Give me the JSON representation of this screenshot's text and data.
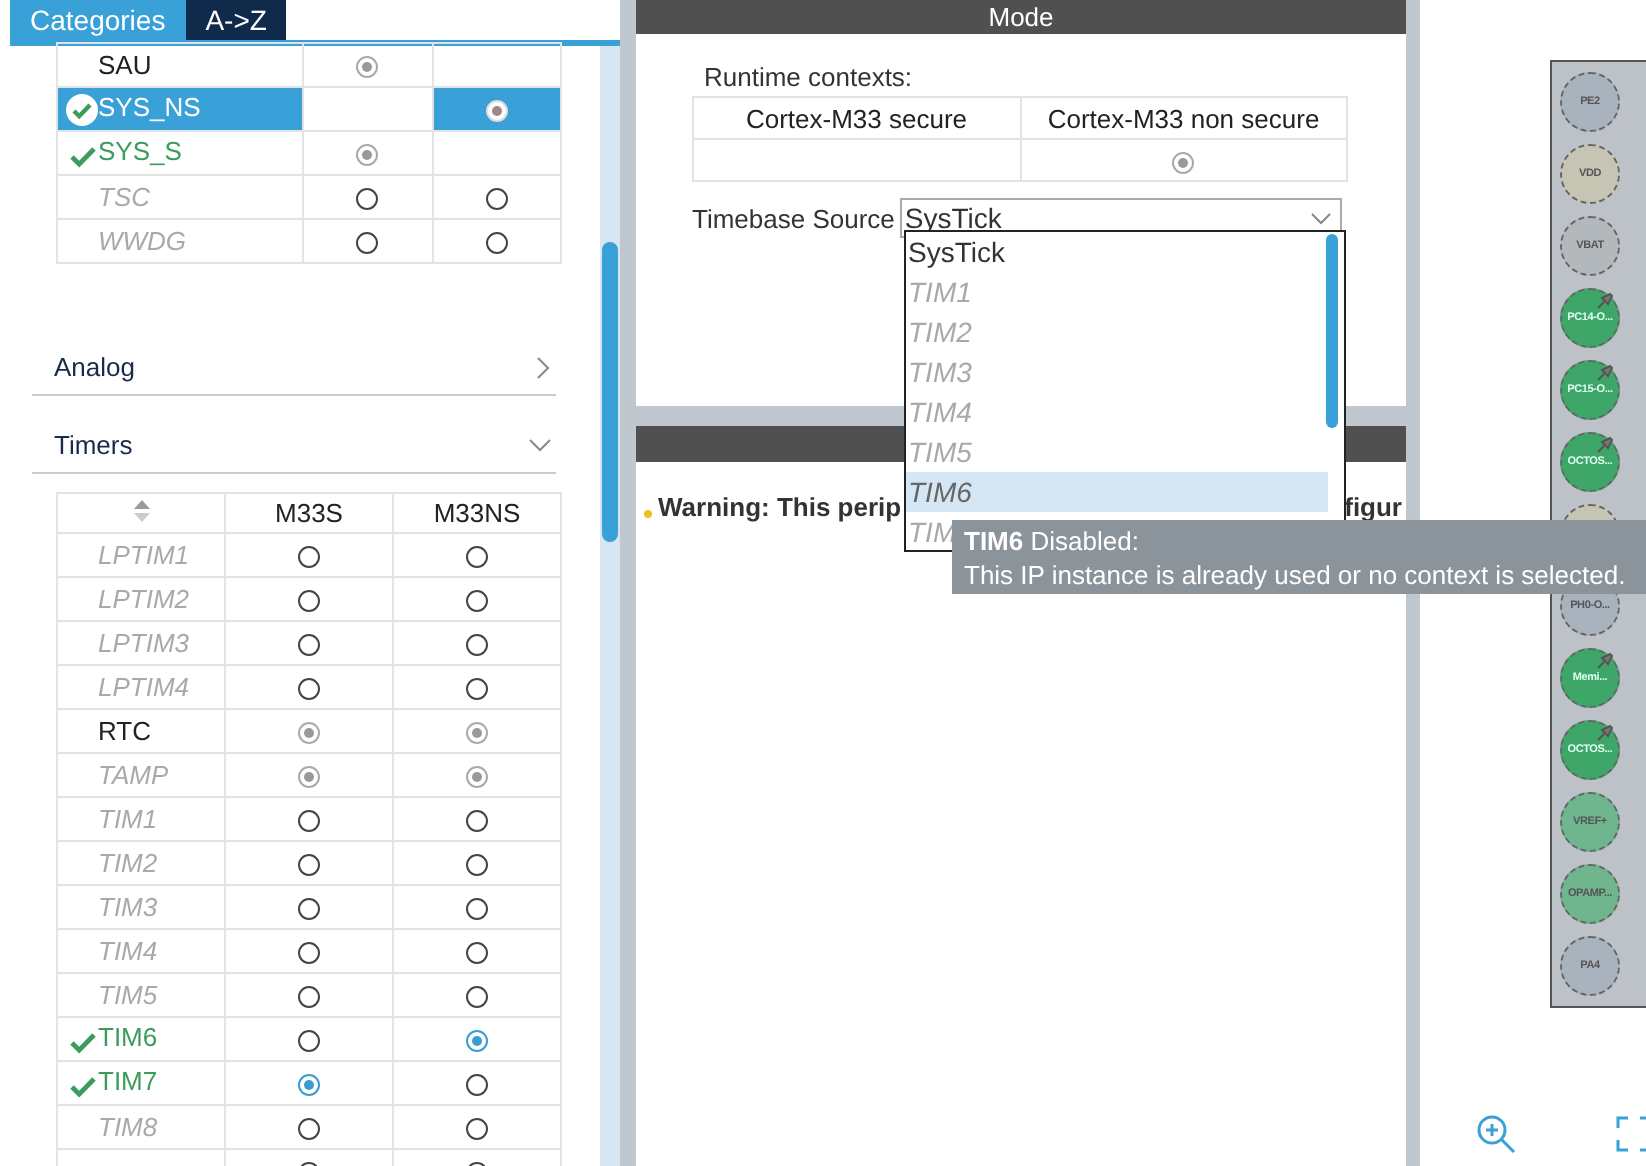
{
  "tabs": [
    {
      "label": "Categories",
      "selected": true
    },
    {
      "label": "A->Z",
      "selected": false
    }
  ],
  "system_rows": [
    {
      "name": "SAU",
      "disabled": false,
      "configured": false,
      "selected": false,
      "m33s": {
        "checked": true,
        "disabled": true
      }
    },
    {
      "name": "SYS_NS",
      "disabled": false,
      "configured": true,
      "selected": true,
      "m33ns": {
        "checked": true,
        "disabled": true
      }
    },
    {
      "name": "SYS_S",
      "disabled": false,
      "configured": true,
      "selected": false,
      "m33s": {
        "checked": true,
        "disabled": true
      }
    },
    {
      "name": "TSC",
      "disabled": true,
      "configured": false,
      "selected": false,
      "m33s": {
        "checked": false,
        "disabled": false
      },
      "m33ns": {
        "checked": false,
        "disabled": false
      }
    },
    {
      "name": "WWDG",
      "disabled": true,
      "configured": false,
      "selected": false,
      "m33s": {
        "checked": false,
        "disabled": false
      },
      "m33ns": {
        "checked": false,
        "disabled": false
      }
    }
  ],
  "categories": [
    {
      "label": "Analog",
      "expanded": false
    },
    {
      "label": "Timers",
      "expanded": true,
      "columns": [
        "M33S",
        "M33NS"
      ],
      "rows": [
        {
          "name": "LPTIM1",
          "disabled": true,
          "configured": false,
          "m33s": {
            "checked": false,
            "disabled": false
          },
          "m33ns": {
            "checked": false,
            "disabled": false
          }
        },
        {
          "name": "LPTIM2",
          "disabled": true,
          "configured": false,
          "m33s": {
            "checked": false,
            "disabled": false
          },
          "m33ns": {
            "checked": false,
            "disabled": false
          }
        },
        {
          "name": "LPTIM3",
          "disabled": true,
          "configured": false,
          "m33s": {
            "checked": false,
            "disabled": false
          },
          "m33ns": {
            "checked": false,
            "disabled": false
          }
        },
        {
          "name": "LPTIM4",
          "disabled": true,
          "configured": false,
          "m33s": {
            "checked": false,
            "disabled": false
          },
          "m33ns": {
            "checked": false,
            "disabled": false
          }
        },
        {
          "name": "RTC",
          "disabled": false,
          "configured": false,
          "m33s": {
            "checked": true,
            "disabled": true
          },
          "m33ns": {
            "checked": true,
            "disabled": true
          }
        },
        {
          "name": "TAMP",
          "disabled": true,
          "configured": false,
          "m33s": {
            "checked": true,
            "disabled": true
          },
          "m33ns": {
            "checked": true,
            "disabled": true
          }
        },
        {
          "name": "TIM1",
          "disabled": true,
          "configured": false,
          "m33s": {
            "checked": false,
            "disabled": false
          },
          "m33ns": {
            "checked": false,
            "disabled": false
          }
        },
        {
          "name": "TIM2",
          "disabled": true,
          "configured": false,
          "m33s": {
            "checked": false,
            "disabled": false
          },
          "m33ns": {
            "checked": false,
            "disabled": false
          }
        },
        {
          "name": "TIM3",
          "disabled": true,
          "configured": false,
          "m33s": {
            "checked": false,
            "disabled": false
          },
          "m33ns": {
            "checked": false,
            "disabled": false
          }
        },
        {
          "name": "TIM4",
          "disabled": true,
          "configured": false,
          "m33s": {
            "checked": false,
            "disabled": false
          },
          "m33ns": {
            "checked": false,
            "disabled": false
          }
        },
        {
          "name": "TIM5",
          "disabled": true,
          "configured": false,
          "m33s": {
            "checked": false,
            "disabled": false
          },
          "m33ns": {
            "checked": false,
            "disabled": false
          }
        },
        {
          "name": "TIM6",
          "disabled": false,
          "configured": true,
          "m33s": {
            "checked": false,
            "disabled": false
          },
          "m33ns": {
            "checked": true,
            "disabled": false
          }
        },
        {
          "name": "TIM7",
          "disabled": false,
          "configured": true,
          "m33s": {
            "checked": true,
            "disabled": false
          },
          "m33ns": {
            "checked": false,
            "disabled": false
          }
        },
        {
          "name": "TIM8",
          "disabled": true,
          "configured": false,
          "m33s": {
            "checked": false,
            "disabled": false
          },
          "m33ns": {
            "checked": false,
            "disabled": false
          }
        },
        {
          "disabled": true,
          "configured": false,
          "m33s": {
            "checked": false,
            "disabled": false
          },
          "m33ns": {
            "checked": false,
            "disabled": false
          }
        }
      ]
    }
  ],
  "mode": {
    "title": "Mode",
    "runtime_label": "Runtime contexts:",
    "runtime_contexts": [
      {
        "name": "Cortex-M33 secure"
      },
      {
        "name": "Cortex-M33 non secure",
        "radio": {
          "checked": true,
          "disabled": true
        }
      }
    ],
    "timebase_label": "Timebase Source",
    "timebase_value": "SysTick",
    "options": [
      {
        "label": "SysTick",
        "disabled": false,
        "hovered": false
      },
      {
        "label": "TIM1",
        "disabled": true,
        "hovered": false
      },
      {
        "label": "TIM2",
        "disabled": true,
        "hovered": false
      },
      {
        "label": "TIM3",
        "disabled": true,
        "hovered": false
      },
      {
        "label": "TIM4",
        "disabled": true,
        "hovered": false
      },
      {
        "label": "TIM5",
        "disabled": true,
        "hovered": false
      },
      {
        "label": "TIM6",
        "disabled": true,
        "hovered": true
      },
      {
        "label": "TIM",
        "disabled": true,
        "hovered": false
      }
    ],
    "warning_start": "Warning: This perip",
    "warning_end": "figur",
    "tooltip": {
      "title": "**TIM6** Disabled:",
      "text": "This IP instance is already used or no context is selected."
    }
  },
  "pins": [
    {
      "label": "PE2",
      "color": "#a9b3be",
      "pinned": false
    },
    {
      "label": "VDD",
      "color": "#c6c4b2",
      "pinned": false
    },
    {
      "label": "VBAT",
      "color": "#b3b8bd",
      "pinned": false
    },
    {
      "label": "PC14-O...",
      "color": "#3fa66a",
      "pinned": true
    },
    {
      "label": "PC15-O...",
      "color": "#3fa66a",
      "pinned": true
    },
    {
      "label": "OCTOS...",
      "color": "#3fa66a",
      "pinned": true
    },
    {
      "color": "#c6c4b2"
    },
    {
      "label": "PH0-O...",
      "color": "#a9b3be",
      "pinned": false
    },
    {
      "label": "Memi...",
      "color": "#3fa66a",
      "pinned": true
    },
    {
      "label": "OCTOS...",
      "color": "#3fa66a",
      "pinned": true
    },
    {
      "label": "VREF+",
      "color": "#6fb58e",
      "pinned": false
    },
    {
      "label": "OPAMP...",
      "color": "#6fb58e",
      "pinned": false
    },
    {
      "label": "PA4",
      "color": "#a9b3be",
      "pinned": false
    }
  ]
}
